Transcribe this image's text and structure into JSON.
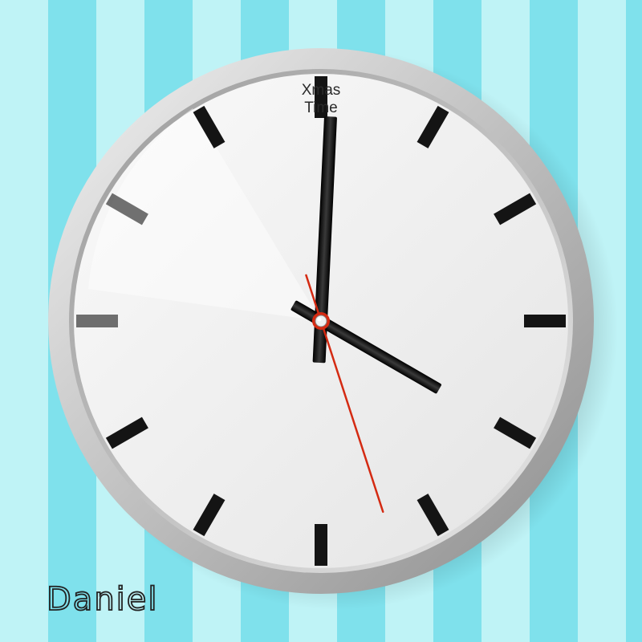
{
  "clock": {
    "brand_line1": "Xmas",
    "brand_line2": "Time",
    "time": {
      "hours": 4,
      "minutes": 0,
      "seconds": 27
    },
    "colors": {
      "face": "#ebebeb",
      "bezel": "#bdbdbd",
      "hands": "#111111",
      "second_hand": "#d42a12",
      "markers": "#141414"
    },
    "hour_markers": 12
  },
  "signature": {
    "text": "Daniel"
  },
  "background": {
    "stripe_light": "#bff3f6",
    "stripe_dark": "#7fe1ec"
  }
}
